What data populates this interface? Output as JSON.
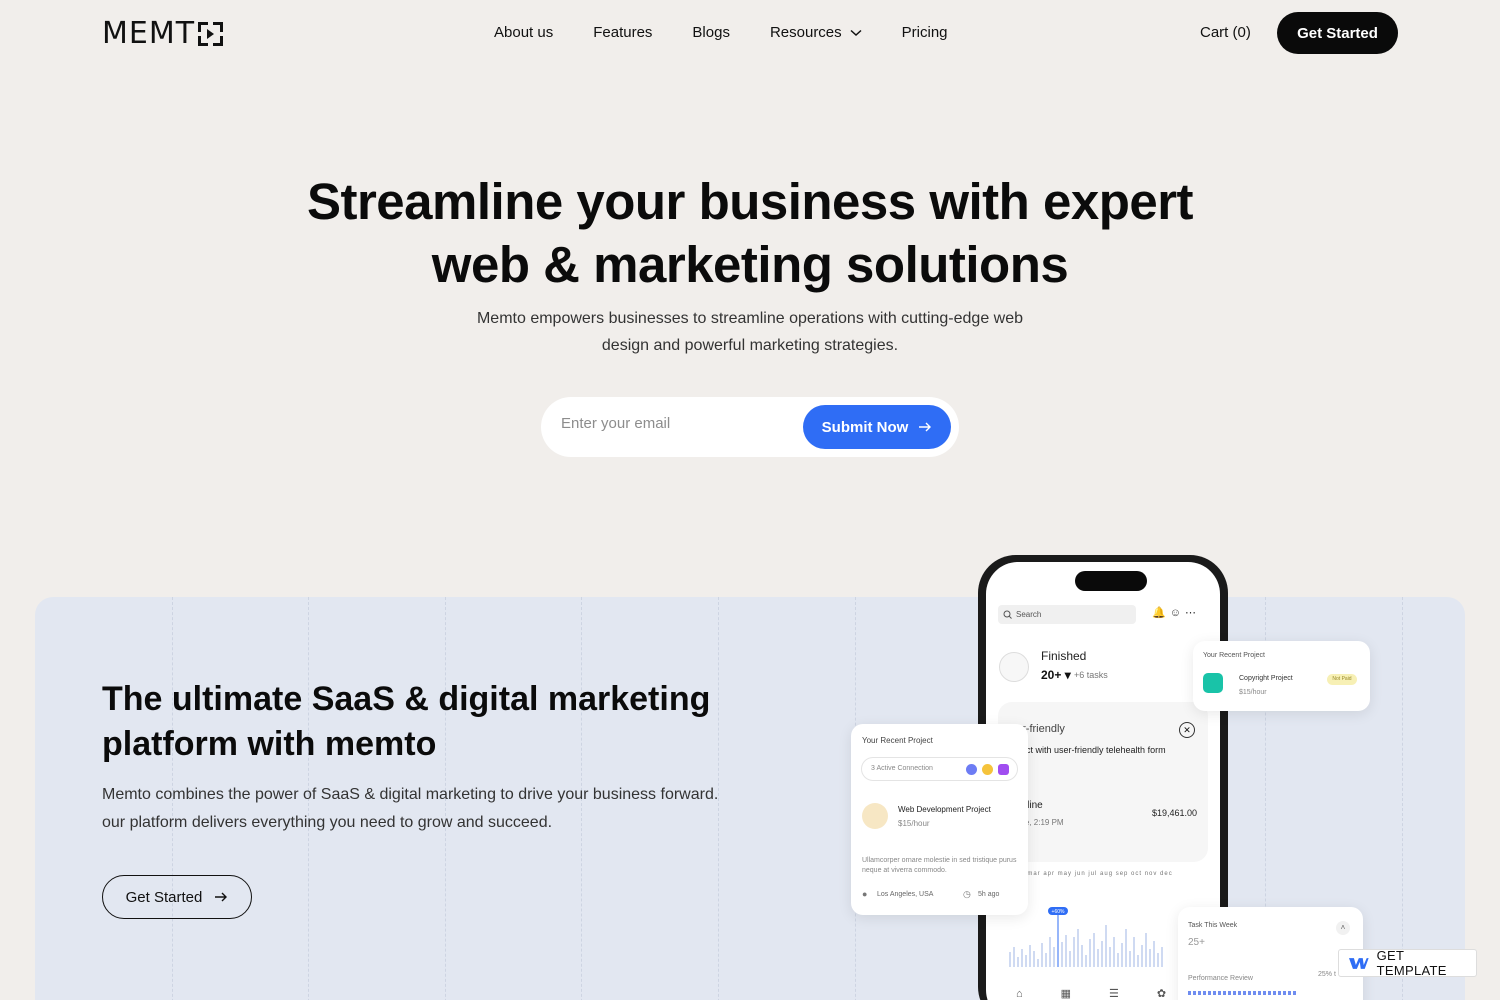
{
  "brand": {
    "logo_text": "MEMT"
  },
  "nav": {
    "items": [
      {
        "label": "About us"
      },
      {
        "label": "Features"
      },
      {
        "label": "Blogs"
      },
      {
        "label": "Resources"
      },
      {
        "label": "Pricing"
      }
    ],
    "cart_label": "Cart (0)",
    "cta_label": "Get Started"
  },
  "hero": {
    "title_line1": "Streamline your business with expert",
    "title_line2": "web & marketing solutions",
    "subtitle_line1": "Memto empowers businesses to streamline operations with cutting-edge web",
    "subtitle_line2": "design and powerful marketing strategies.",
    "email_placeholder": "Enter your email",
    "submit_label": "Submit Now"
  },
  "feature": {
    "title_line1": "The ultimate SaaS & digital marketing",
    "title_line2": "platform with memto",
    "desc_line1": "Memto combines the power of SaaS & digital marketing to drive your business forward.",
    "desc_line2": "our platform delivers everything you need to grow and succeed.",
    "cta_label": "Get Started"
  },
  "phone": {
    "search_placeholder": "Search",
    "finished_label": "Finished",
    "finished_count": "20+",
    "tasks_delta": "+6 tasks",
    "card_title": "er-friendly",
    "card_text": "nect with user-friendly telehealth form",
    "online_label": "online",
    "online_date": "une, 2:19 PM",
    "amount": "$19,461.00",
    "months": "ob mar apr may jun jul aug sep oct nov dec",
    "highlight_value": "+60%"
  },
  "card_left": {
    "heading": "Your Recent Project",
    "connection": "3 Active Connection",
    "project_name": "Web Development Project",
    "rate": "$15/hour",
    "desc": "Ullamcorper ornare molestie in sed tristique purus neque at viverra commodo.",
    "location": "Los Angeles, USA",
    "time": "5h ago"
  },
  "card_right": {
    "heading": "Your Recent Project",
    "project_name": "Copyright Project",
    "rate": "$15/hour",
    "status": "Not Paid"
  },
  "card_bottom": {
    "heading": "Task This Week",
    "count": "25+",
    "review_label": "Performance Review",
    "percent": "25% t"
  },
  "badge": {
    "label": "GET TEMPLATE"
  },
  "colors": {
    "accent": "#2f6df5",
    "panel": "#e2e7f1",
    "background": "#f1eeeb"
  }
}
